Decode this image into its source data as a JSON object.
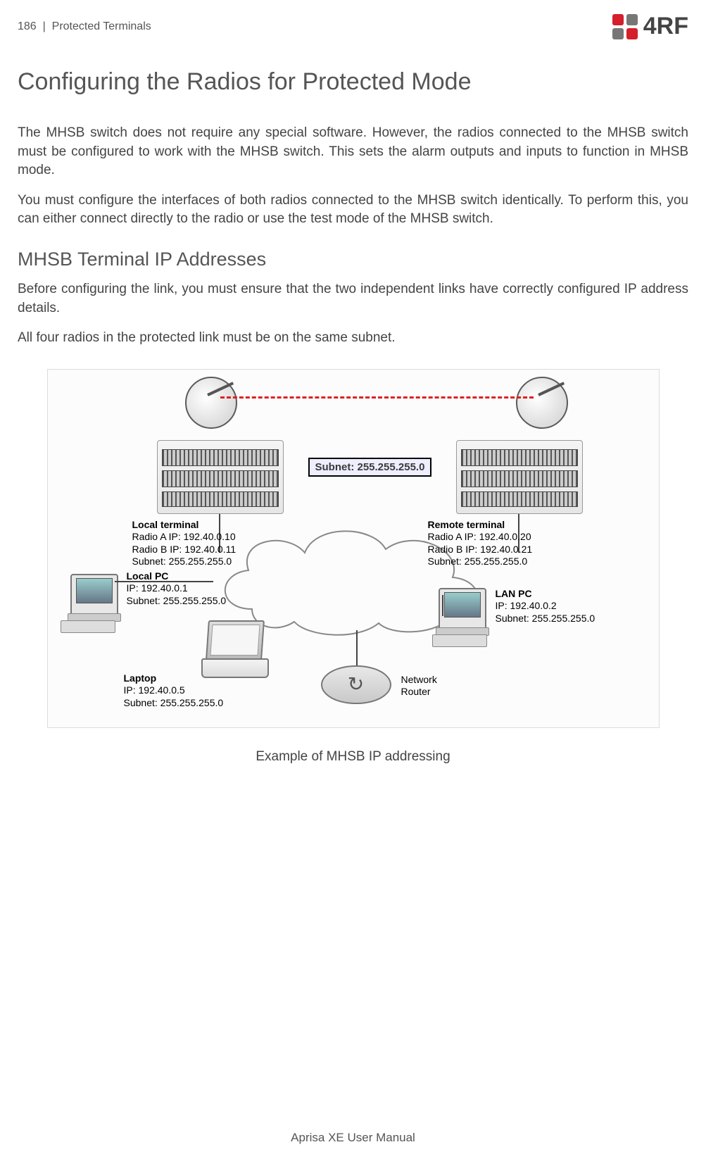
{
  "header": {
    "page_number": "186",
    "separator": "|",
    "section": "Protected Terminals",
    "logo_text": "4RF"
  },
  "headings": {
    "main": "Configuring the Radios for Protected Mode",
    "sub": "MHSB Terminal IP Addresses"
  },
  "paragraphs": {
    "p1": "The MHSB switch does not require any special software. However, the radios connected to the MHSB switch must be configured to work with the MHSB switch. This sets the alarm outputs and inputs to function in MHSB mode.",
    "p2": "You must configure the interfaces of both radios connected to the MHSB switch identically. To perform this, you can either connect directly to the radio or use the test mode of the MHSB switch.",
    "p3": "Before configuring the link, you must ensure that the two independent links have correctly configured IP address details.",
    "p4": "All four radios in the protected link must be on the same subnet."
  },
  "diagram": {
    "subnet_box": "Subnet: 255.255.255.0",
    "local_terminal": {
      "title": "Local terminal",
      "l1": "Radio A IP: 192.40.0.10",
      "l2": "Radio B IP: 192.40.0.11",
      "l3": "Subnet: 255.255.255.0"
    },
    "remote_terminal": {
      "title": "Remote terminal",
      "l1": "Radio A IP: 192.40.0.20",
      "l2": "Radio B IP: 192.40.0.21",
      "l3": "Subnet: 255.255.255.0"
    },
    "local_pc": {
      "title": "Local PC",
      "l1": "IP: 192.40.0.1",
      "l2": "Subnet: 255.255.255.0"
    },
    "lan_pc": {
      "title": "LAN PC",
      "l1": "IP: 192.40.0.2",
      "l2": "Subnet: 255.255.255.0"
    },
    "laptop": {
      "title": "Laptop",
      "l1": "IP: 192.40.0.5",
      "l2": "Subnet: 255.255.255.0"
    },
    "router": {
      "title": "Network",
      "l2": "Router"
    }
  },
  "caption": "Example of MHSB IP addressing",
  "footer": "Aprisa XE User Manual"
}
